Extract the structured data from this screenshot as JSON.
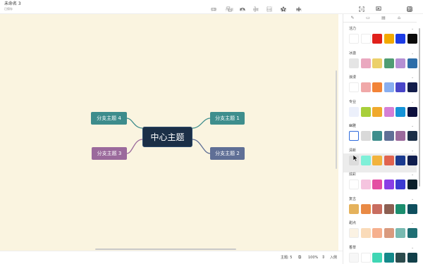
{
  "document": {
    "title": "未命名 3",
    "status": "已保存"
  },
  "toolbar": {
    "center": [
      {
        "name": "tool-topic",
        "label": "主题",
        "icon": "topic-icon",
        "active": false
      },
      {
        "name": "tool-subtopic",
        "label": "子主题",
        "icon": "subtopic-icon",
        "active": false
      },
      {
        "name": "tool-link",
        "label": "联系",
        "icon": "link-curve-icon",
        "active": true
      },
      {
        "name": "tool-summary",
        "label": "概要",
        "icon": "summary-icon",
        "active": false
      },
      {
        "name": "tool-boundary",
        "label": "外框",
        "icon": "boundary-icon",
        "active": false
      },
      {
        "name": "tool-mark",
        "label": "标记",
        "icon": "star-icon",
        "active": true
      },
      {
        "name": "tool-insert",
        "label": "插入",
        "icon": "plus-icon",
        "active": true
      }
    ],
    "right": [
      {
        "name": "tool-zen",
        "label": "ZEN",
        "icon": "zen-icon"
      },
      {
        "name": "tool-present",
        "label": "演示",
        "icon": "present-icon"
      },
      {
        "name": "tool-format",
        "label": "格式",
        "icon": "format-panel-icon"
      }
    ]
  },
  "mindmap": {
    "root": {
      "label": "中心主题",
      "color": "#1b2f47"
    },
    "branches": [
      {
        "label": "分支主题 1",
        "color": "#3e8e8d"
      },
      {
        "label": "分支主题 2",
        "color": "#5f6f96"
      },
      {
        "label": "分支主题 3",
        "color": "#9b6a9c"
      },
      {
        "label": "分支主题 4",
        "color": "#3d8c8c"
      }
    ]
  },
  "statusbar": {
    "topic_label": "主题: 5",
    "zoom": "100%",
    "enter_label": "入侧"
  },
  "panel": {
    "tabs": [
      {
        "name": "tab-style",
        "icon": "brush-icon",
        "active": false
      },
      {
        "name": "tab-map",
        "icon": "map-icon",
        "active": false
      },
      {
        "name": "tab-note",
        "icon": "note-icon",
        "active": false
      },
      {
        "name": "tab-theme",
        "icon": "theme-icon",
        "active": true
      }
    ],
    "themes": [
      {
        "label": "活力",
        "colors": [
          "#ffffff",
          "#ffffff",
          "#e0201b",
          "#f2a900",
          "#1d3de6",
          "#0a0a0a"
        ],
        "selected": -1,
        "highlight": false
      },
      {
        "label": "冰激",
        "colors": [
          "#e5e5e5",
          "#eaa8bf",
          "#ecd06a",
          "#4f9d73",
          "#b48fd3",
          "#2d6da8"
        ],
        "selected": -1,
        "highlight": false
      },
      {
        "label": "浪漫",
        "colors": [
          "#ffffff",
          "#f0a8a8",
          "#f28337",
          "#88aef0",
          "#4a46c9",
          "#121c4a"
        ],
        "selected": -1,
        "highlight": false
      },
      {
        "label": "专业",
        "colors": [
          "#ecf0fb",
          "#a8cf3a",
          "#f0a92c",
          "#d47fd6",
          "#1593d8",
          "#0c0f3d"
        ],
        "selected": -1,
        "highlight": false
      },
      {
        "label": "幽雅",
        "colors": [
          "#ffffff",
          "#d9d9d9",
          "#3e8e8d",
          "#5f6f96",
          "#9b6a9c",
          "#1b2f47"
        ],
        "selected": 0,
        "highlight": false
      },
      {
        "label": "清新",
        "colors": [
          "#dcdcdc",
          "#7ff0d8",
          "#f2b33d",
          "#e0634f",
          "#1a3a8f",
          "#0f1d4d"
        ],
        "selected": -1,
        "highlight": true
      },
      {
        "label": "炫彩",
        "colors": [
          "#ffffff",
          "#f5c4df",
          "#e44fa3",
          "#8a3ee5",
          "#3b3ad0",
          "#0b1f2a"
        ],
        "selected": -1,
        "highlight": false
      },
      {
        "label": "复古",
        "colors": [
          "#e5b25c",
          "#e98a45",
          "#c86d60",
          "#8c5f52",
          "#1b8e6e",
          "#0f4f5e"
        ],
        "selected": -1,
        "highlight": false
      },
      {
        "label": "甜点",
        "colors": [
          "#fbf2e3",
          "#fadbb9",
          "#f6b08e",
          "#d99a7e",
          "#78bab1",
          "#1f6f74"
        ],
        "selected": -1,
        "highlight": false
      },
      {
        "label": "香草",
        "colors": [
          "#f7f7f7",
          "#ffffff",
          "#3fd6b4",
          "#14898a",
          "#2c4b4d",
          "#123f49"
        ],
        "selected": -1,
        "highlight": false
      }
    ]
  }
}
